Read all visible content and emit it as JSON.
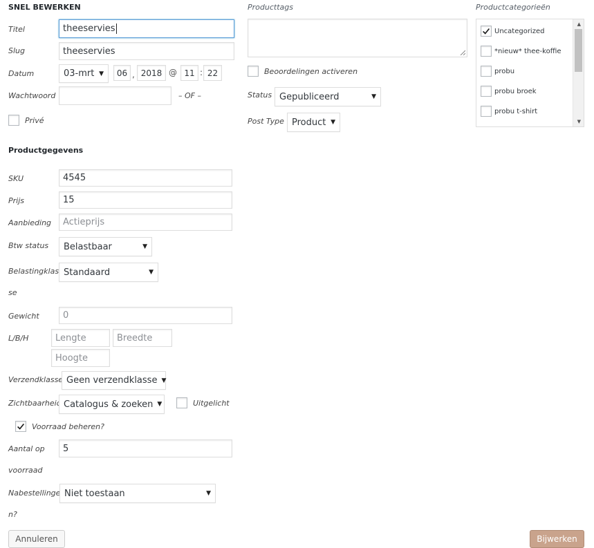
{
  "quick_edit": {
    "title": "SNEL BEWERKEN",
    "labels": {
      "title": "Titel",
      "slug": "Slug",
      "date": "Datum",
      "password": "Wachtwoord",
      "or": "– OF –",
      "private": "Privé"
    },
    "fields": {
      "title": "theeservies",
      "slug": "theeservies",
      "month": "03-mrt",
      "day": "06",
      "year": "2018",
      "at": "@",
      "hour": "11",
      "minute": "22",
      "comma": ",",
      "colon": ":",
      "password": ""
    }
  },
  "product_data": {
    "title": "Productgegevens",
    "labels": {
      "sku": "SKU",
      "price": "Prijs",
      "sale": "Aanbieding",
      "tax_status": "Btw status",
      "tax_class_1": "Belastingklas",
      "tax_class_2": "se",
      "weight": "Gewicht",
      "dimensions": "L/B/H",
      "shipping_class": "Verzendklasse",
      "visibility": "Zichtbaarheid",
      "featured": "Uitgelicht",
      "manage_stock": "Voorraad beheren?",
      "stock_qty_1": "Aantal op",
      "stock_qty_2": "voorraad",
      "backorders_1": "Nabestellinge",
      "backorders_2": "n?"
    },
    "fields": {
      "sku": "4545",
      "price": "15",
      "sale_placeholder": "Actieprijs",
      "tax_status": "Belastbaar",
      "tax_class": "Standaard",
      "weight_placeholder": "0",
      "length_placeholder": "Lengte",
      "width_placeholder": "Breedte",
      "height_placeholder": "Hoogte",
      "shipping_class": "Geen verzendklasse",
      "visibility": "Catalogus & zoeken",
      "stock_qty": "5",
      "backorders": "Niet toestaan"
    },
    "manage_stock_checked": true,
    "featured_checked": false
  },
  "tags": {
    "title": "Producttags",
    "value": ""
  },
  "reviews": {
    "label": "Beoordelingen activeren",
    "checked": false
  },
  "status": {
    "label": "Status",
    "value": "Gepubliceerd"
  },
  "post_type": {
    "label": "Post Type",
    "value": "Product"
  },
  "categories": {
    "title": "Productcategorieën",
    "items": [
      {
        "label": "Uncategorized",
        "checked": true
      },
      {
        "label": "*nieuw* thee-koffie",
        "checked": false
      },
      {
        "label": "probu",
        "checked": false
      },
      {
        "label": "probu broek",
        "checked": false
      },
      {
        "label": "probu t-shirt",
        "checked": false
      }
    ]
  },
  "actions": {
    "cancel": "Annuleren",
    "update": "Bijwerken"
  },
  "colors": {
    "primary_button": "#c9a38c",
    "focus_border": "#5b9dd9"
  }
}
